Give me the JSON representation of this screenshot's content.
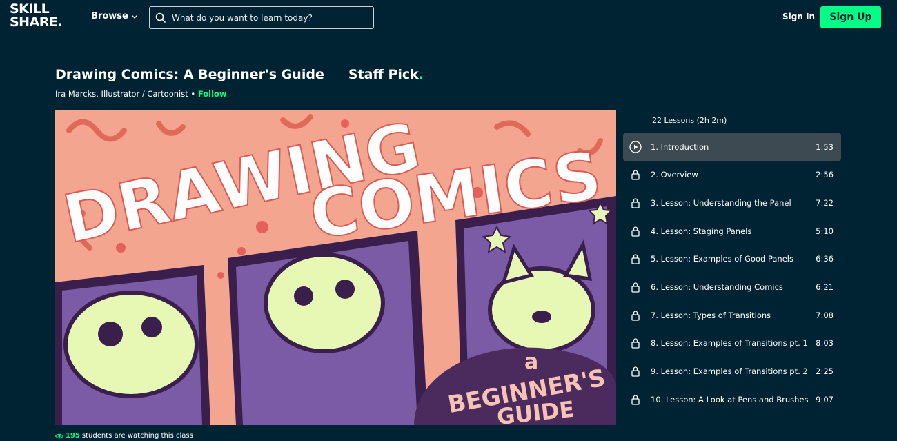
{
  "header": {
    "logo_top": "SKILL",
    "logo_bottom": "SHARE.",
    "browse_label": "Browse",
    "search_placeholder": "What do you want to learn today?",
    "sign_in_label": "Sign In",
    "sign_up_label": "Sign Up"
  },
  "course": {
    "title": "Drawing Comics: A Beginner's Guide",
    "staff_pick_text": "Staff Pick",
    "teacher": "Ira Marcks, Illustrator / Cartoonist",
    "separator": "•",
    "follow_label": "Follow",
    "watching_count": "195",
    "watching_text": "students are watching this class"
  },
  "video": {
    "art_title_line1": "DRAWING",
    "art_title_line2": "COMICS",
    "art_sub_a": "a",
    "art_sub_line1": "BEGINNER'S",
    "art_sub_line2": "GUIDE"
  },
  "lessons": {
    "summary": "22 Lessons (2h 2m)",
    "items": [
      {
        "name": "1. Introduction",
        "duration": "1:53",
        "icon": "play-icon",
        "active": true
      },
      {
        "name": "2. Overview",
        "duration": "2:56",
        "icon": "lock-icon"
      },
      {
        "name": "3. Lesson: Understanding the Panel",
        "duration": "7:22",
        "icon": "lock-icon"
      },
      {
        "name": "4. Lesson: Staging Panels",
        "duration": "5:10",
        "icon": "lock-icon"
      },
      {
        "name": "5. Lesson: Examples of Good Panels",
        "duration": "6:36",
        "icon": "lock-icon"
      },
      {
        "name": "6. Lesson: Understanding Comics",
        "duration": "6:21",
        "icon": "lock-icon"
      },
      {
        "name": "7. Lesson: Types of Transitions",
        "duration": "7:08",
        "icon": "lock-icon"
      },
      {
        "name": "8. Lesson: Examples of Transitions pt. 1",
        "duration": "8:03",
        "icon": "lock-icon"
      },
      {
        "name": "9. Lesson: Examples of Transitions pt. 2",
        "duration": "2:25",
        "icon": "lock-icon"
      },
      {
        "name": "10. Lesson: A Look at Pens and Brushes",
        "duration": "9:07",
        "icon": "lock-icon"
      }
    ]
  },
  "colors": {
    "background": "#002333",
    "accent": "#00ff84",
    "active_row": "#3d4a52"
  }
}
